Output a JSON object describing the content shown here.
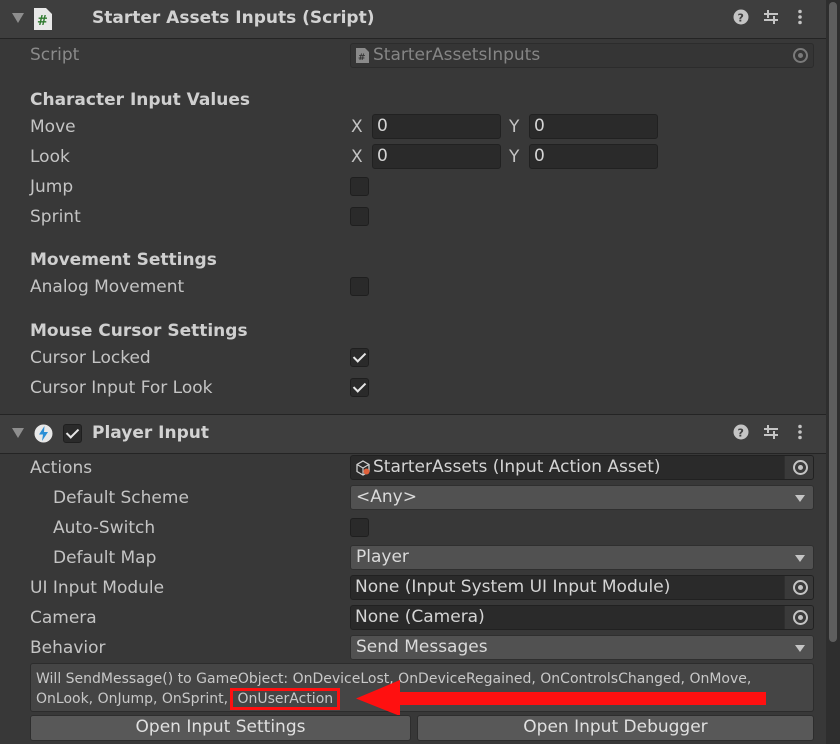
{
  "starter": {
    "title": "Starter Assets Inputs (Script)",
    "script_label": "Script",
    "script_value": "StarterAssetsInputs",
    "character_section": "Character Input Values",
    "move_label": "Move",
    "look_label": "Look",
    "jump_label": "Jump",
    "sprint_label": "Sprint",
    "x_label": "X",
    "y_label": "Y",
    "move_x": "0",
    "move_y": "0",
    "look_x": "0",
    "look_y": "0",
    "jump_checked": false,
    "sprint_checked": false,
    "movement_section": "Movement Settings",
    "analog_label": "Analog Movement",
    "analog_checked": false,
    "mouse_section": "Mouse Cursor Settings",
    "cursor_locked_label": "Cursor Locked",
    "cursor_locked_checked": true,
    "cursor_look_label": "Cursor Input For Look",
    "cursor_look_checked": true
  },
  "player_input": {
    "title": "Player Input",
    "enabled": true,
    "actions_label": "Actions",
    "actions_value": "StarterAssets (Input Action Asset)",
    "default_scheme_label": "Default Scheme",
    "default_scheme_value": "<Any>",
    "auto_switch_label": "Auto-Switch",
    "auto_switch_checked": false,
    "default_map_label": "Default Map",
    "default_map_value": "Player",
    "ui_module_label": "UI Input Module",
    "ui_module_value": "None (Input System UI Input Module)",
    "camera_label": "Camera",
    "camera_value": "None (Camera)",
    "behavior_label": "Behavior",
    "behavior_value": "Send Messages",
    "help_line1": "Will SendMessage() to GameObject: OnDeviceLost, OnDeviceRegained, OnControlsChanged, OnMove,",
    "help_line2_prefix": "OnLook, OnJump, OnSprint, ",
    "help_highlight": "OnUserAction",
    "open_settings_label": "Open Input Settings",
    "open_debugger_label": "Open Input Debugger"
  },
  "colors": {
    "annotation": "#ff1010",
    "background": "#383838",
    "header": "#3e3e3e"
  }
}
